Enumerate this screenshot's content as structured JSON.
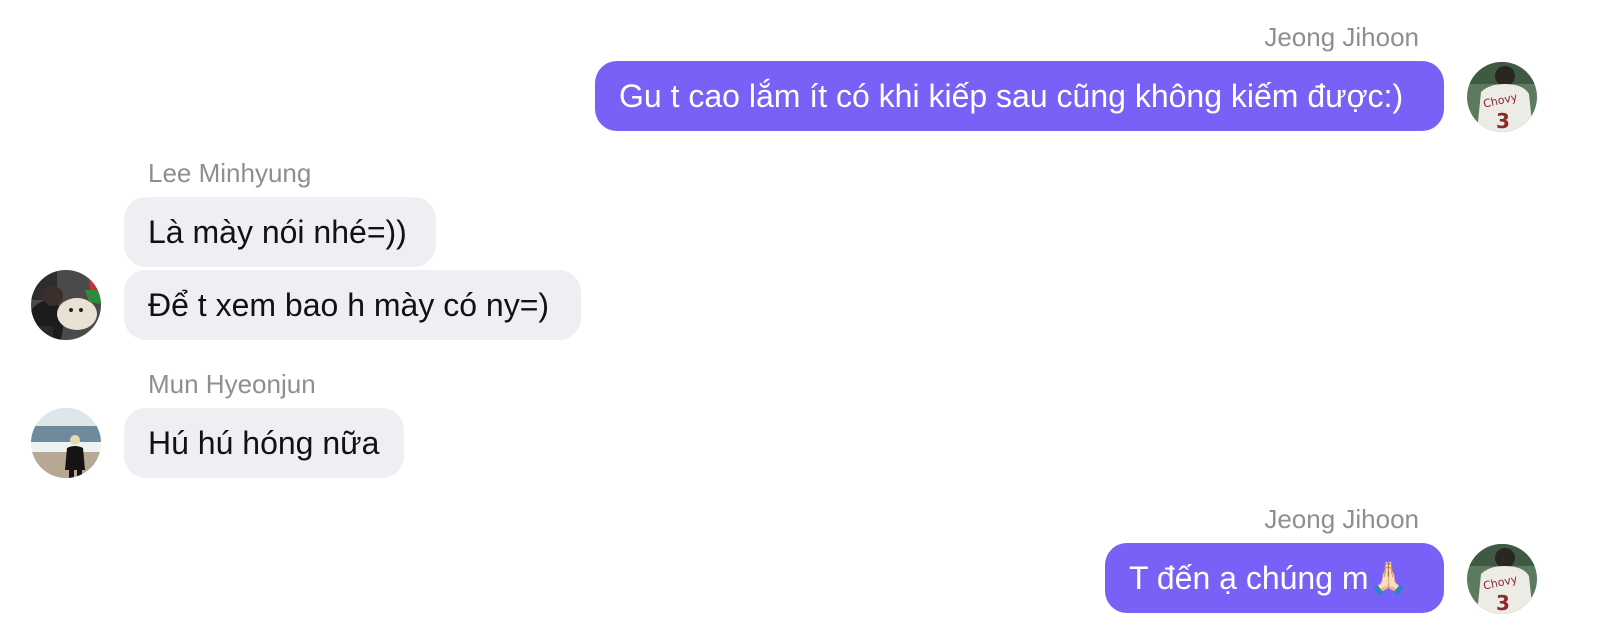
{
  "messages": [
    {
      "sender": "Jeong Jihoon",
      "text": "Gu t cao lắm ít có khi kiếp sau cũng không kiếm được:)",
      "side": "right"
    },
    {
      "sender": "Lee Minhyung",
      "text": "Là mày nói nhé=))",
      "side": "left"
    },
    {
      "sender": "",
      "text": "Để t xem bao h mày có ny=)",
      "side": "left"
    },
    {
      "sender": "Mun Hyeonjun",
      "text": "Hú hú hóng nữa",
      "side": "left"
    },
    {
      "sender": "Jeong Jihoon",
      "text": "T đến ạ chúng m🙏🏻",
      "side": "right"
    }
  ],
  "colors": {
    "outgoing_bubble": "#7861f7",
    "incoming_bubble": "#efeff3",
    "sender_name": "#8e8e93"
  },
  "avatars": {
    "jeong_jihoon": {
      "icon": "jersey-photo-avatar",
      "jersey_text": "Chovy",
      "jersey_number": "3"
    },
    "lee_minhyung": {
      "icon": "person-with-plush-avatar"
    },
    "mun_hyeonjun": {
      "icon": "beach-photo-avatar"
    }
  }
}
